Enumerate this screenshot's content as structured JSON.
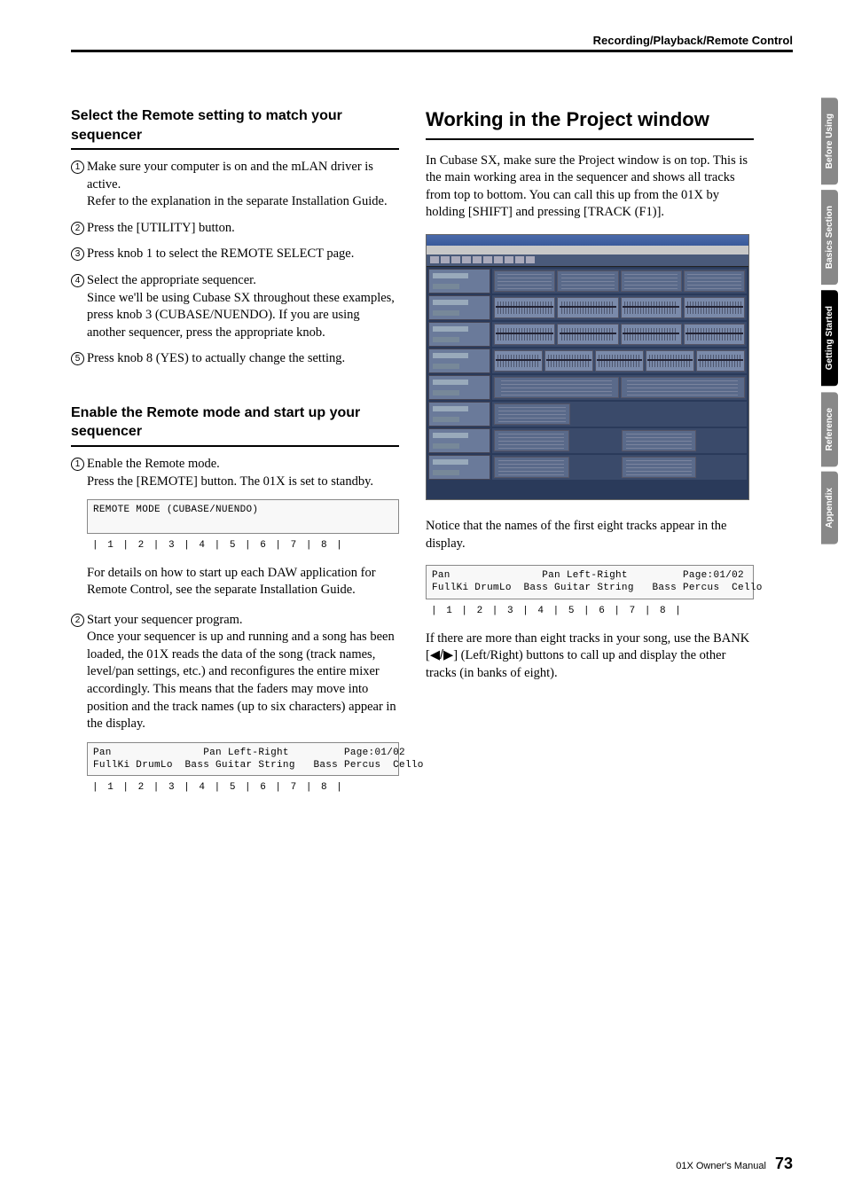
{
  "header": {
    "breadcrumb": "Recording/Playback/Remote Control"
  },
  "left": {
    "section1": {
      "title": "Select the Remote setting to match your sequencer",
      "steps": [
        {
          "n": "1",
          "body": "Make sure your computer is on and the mLAN driver is active.",
          "sub": "Refer to the explanation in the separate Installation Guide."
        },
        {
          "n": "2",
          "body": "Press the [UTILITY] button."
        },
        {
          "n": "3",
          "body": "Press knob 1 to select the REMOTE SELECT page."
        },
        {
          "n": "4",
          "body": "Select the appropriate sequencer.",
          "sub": "Since we'll be using Cubase SX throughout these examples, press knob 3 (CUBASE/NUENDO).  If you are using another sequencer, press the appropriate knob."
        },
        {
          "n": "5",
          "body": "Press knob 8 (YES) to actually change the setting."
        }
      ]
    },
    "section2": {
      "title": "Enable the Remote mode and start up your sequencer",
      "step1": {
        "n": "1",
        "body": "Enable the Remote mode.",
        "sub": "Press the [REMOTE] button.  The 01X is set to standby."
      },
      "lcd1": {
        "line1": "REMOTE MODE (CUBASE/NUENDO)                 ",
        "line2": "                                            "
      },
      "knobs": "|  1  |  2  |  3  |  4  |  5  |  6  |  7  |  8  |",
      "after1": "For details on how to start up each DAW application for Remote Control, see the separate Installation Guide.",
      "step2": {
        "n": "2",
        "body": "Start your sequencer program.",
        "sub": "Once your sequencer is up and running and a song has been loaded, the 01X reads the data of the song (track names, level/pan settings, etc.) and reconfigures the entire mixer accordingly.  This means that the faders may move into position and the track names (up to six characters) appear in the display."
      },
      "lcd2": {
        "line1": "Pan               Pan Left-Right         Page:01/02",
        "line2": "FullKi DrumLo  Bass Guitar String   Bass Percus  Cello "
      }
    }
  },
  "right": {
    "title": "Working in the Project window",
    "intro": "In Cubase SX, make sure the Project window is on top. This is the main working area in the sequencer and shows all tracks from top to bottom.  You can call this up from the 01X by holding [SHIFT] and pressing [TRACK (F1)].",
    "afterShot": "Notice that the names of the first eight tracks appear in the display.",
    "lcd": {
      "line1": "Pan               Pan Left-Right         Page:01/02",
      "line2": "FullKi DrumLo  Bass Guitar String   Bass Percus  Cello "
    },
    "knobs": "|  1  |  2  |  3  |  4  |  5  |  6  |  7  |  8  |",
    "afterLcd1": "If there are more than eight tracks in your song, use the BANK [",
    "afterLcd_icons": "◀/▶",
    "afterLcd2": "] (Left/Right) buttons to call up and display the other tracks (in banks of eight)."
  },
  "tabs": [
    "Before Using",
    "Basics Section",
    "Getting Started",
    "Reference",
    "Appendix"
  ],
  "active_tab": 2,
  "footer": {
    "label": "01X  Owner's Manual",
    "page": "73"
  }
}
